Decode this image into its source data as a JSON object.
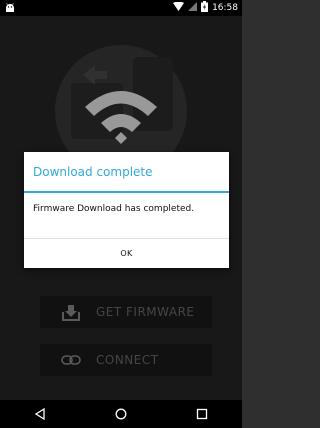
{
  "status_bar": {
    "time": "16:58",
    "left_icon": "android-icon",
    "right_icons": [
      "wifi-icon",
      "signal-icon",
      "battery-icon"
    ]
  },
  "hero": {
    "icon": "wifi-phone-icon"
  },
  "buttons": {
    "get_firmware": {
      "label": "GET FIRMWARE",
      "icon": "download-icon"
    },
    "connect": {
      "label": "CONNECT",
      "icon": "link-icon"
    }
  },
  "dialog": {
    "title": "Download complete",
    "message": "Firmware Download has completed.",
    "ok_label": "OK"
  },
  "nav_bar": {
    "icons": [
      "back-icon",
      "home-icon",
      "recents-icon"
    ]
  },
  "colors": {
    "accent": "#33a9d8",
    "background": "#262626",
    "button": "#1b1b1b"
  }
}
